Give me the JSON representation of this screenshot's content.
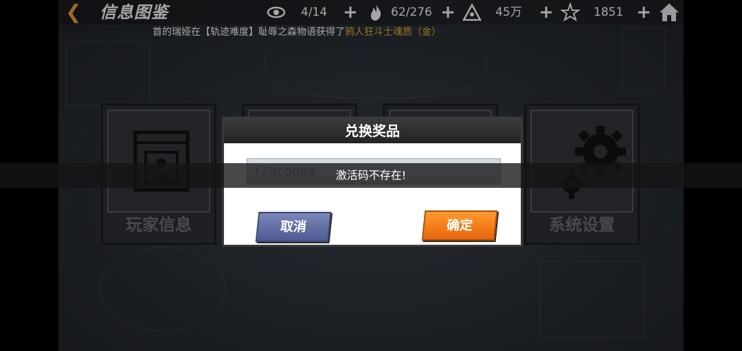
{
  "header": {
    "title": "信息图鉴",
    "stats": [
      {
        "icon": "eye-icon",
        "value": "4/14"
      },
      {
        "icon": "flame-icon",
        "value": "62/276"
      },
      {
        "icon": "triangle-crest-icon",
        "value": "45万"
      },
      {
        "icon": "star-crystal-icon",
        "value": "1851"
      }
    ]
  },
  "marquee": {
    "prefix": "首的瑞娅在【轨迹难度】耻辱之森物语获得了",
    "highlight": "鸦人狂斗士魂质（金）"
  },
  "menu": {
    "cards": [
      {
        "label": "玩家信息",
        "icon": "player-card-icon"
      },
      {
        "label": "",
        "icon": ""
      },
      {
        "label": "",
        "icon": ""
      },
      {
        "label": "系统设置",
        "icon": "gear-icon"
      }
    ]
  },
  "dialog": {
    "title": "兑换奖品",
    "code_value": "f29cb0ea",
    "cancel_label": "取消",
    "ok_label": "确定"
  },
  "toast": {
    "message": "激活码不存在!"
  },
  "colors": {
    "accent_orange": "#f2a230",
    "highlight_gold": "#e8b53a",
    "cancel_blue": "#5a66a0",
    "ok_orange": "#f07a18"
  }
}
